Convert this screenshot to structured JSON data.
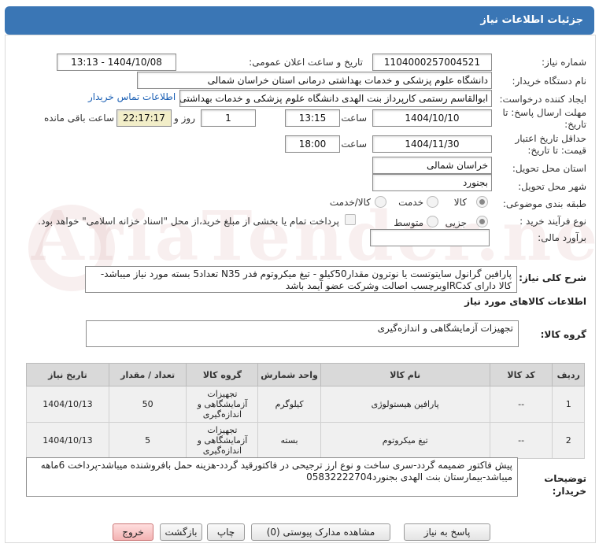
{
  "title": "جزئیات اطلاعات نیاز",
  "fields": {
    "need_number_label": "شماره نیاز:",
    "need_number": "1104000257004521",
    "announce_label": "تاریخ و ساعت اعلان عمومی:",
    "announce_value": "1404/10/08 - 13:13",
    "buyer_org_label": "نام دستگاه خریدار:",
    "buyer_org": "دانشگاه علوم پزشکی و خدمات بهداشتی درمانی استان خراسان شمالی",
    "requester_label": "ایجاد کننده درخواست:",
    "requester": "ابوالقاسم رستمی کارپرداز بنت الهدی دانشگاه علوم پزشکی و خدمات بهداشتی",
    "contact_link": "اطلاعات تماس خریدار",
    "deadline_label1": "مهلت ارسال پاسخ: تا",
    "deadline_label2": "تاریخ:",
    "deadline_date": "1404/10/10",
    "time_label": "ساعت",
    "deadline_time": "13:15",
    "days_value": "1",
    "days_label": "روز و",
    "remaining_time": "22:17:17",
    "remaining_label": "ساعت باقی مانده",
    "validity_label1": "حداقل تاریخ اعتبار",
    "validity_label2": "قیمت: تا تاریخ:",
    "validity_date": "1404/11/30",
    "validity_time_label": "ساعت",
    "validity_time": "18:00",
    "province_label": "استان محل تحویل:",
    "province": "خراسان شمالی",
    "city_label": "شهر محل تحویل:",
    "city": "بجنورد",
    "category_label": "طبقه بندی موضوعی:",
    "category_options": [
      "کالا",
      "خدمت",
      "کالا/خدمت"
    ],
    "process_label": "نوع فرآیند خرید :",
    "process_options": [
      "جزیی",
      "متوسط"
    ],
    "payment_note": "پرداخت تمام یا بخشی از مبلغ خرید،از محل \"اسناد خزانه اسلامی\" خواهد بود.",
    "budget_label": "برآورد مالی:",
    "budget_value": ""
  },
  "description": {
    "label": "شرح کلی نیاز:",
    "text": "پارافین گرانول سایتوتست یا نوترون مقدار50کیلو - تیغ میکروتوم فدر N35 تعداد5 بسته مورد نیاز میباشد-کالا دارای کدIRCوبرچسب اصالت وشرکت عضو آیمد باشد"
  },
  "goods_section": {
    "title": "اطلاعات کالاهای مورد نیاز",
    "group_label": "گروه کالا:",
    "group_value": "تجهیزات آزمایشگاهی و اندازه‌گیری"
  },
  "table": {
    "headers": [
      "ردیف",
      "کد کالا",
      "نام کالا",
      "واحد شمارش",
      "گروه کالا",
      "تعداد / مقدار",
      "تاریخ نیاز"
    ],
    "rows": [
      [
        "1",
        "--",
        "پارافین هیستولوژی",
        "کیلوگرم",
        "تجهیزات آزمایشگاهی و اندازه‌گیری",
        "50",
        "1404/10/13"
      ],
      [
        "2",
        "--",
        "تیغ میکروتوم",
        "بسته",
        "تجهیزات آزمایشگاهی و اندازه‌گیری",
        "5",
        "1404/10/13"
      ]
    ]
  },
  "buyer_notes": {
    "label": "توضیحات خریدار:",
    "text": "پیش فاکتور ضمیمه گردد-سری ساخت و نوع ارز ترجیحی در فاکتورقید گردد-هزینه حمل بافروشنده میباشد-پرداخت 6ماهه میباشد-بیمارستان بنت الهدی بجنورد05832222704"
  },
  "buttons": {
    "reply": "پاسخ به نیاز",
    "attachments": "مشاهده مدارک پیوستی (0)",
    "print": "چاپ",
    "back": "بازگشت",
    "exit": "خروج"
  },
  "watermark": "AriaTender.neT"
}
